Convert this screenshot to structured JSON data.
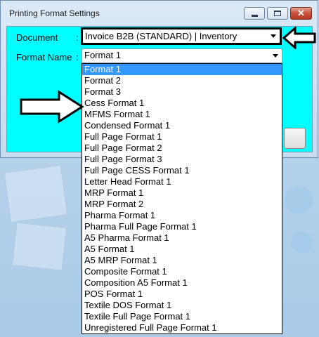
{
  "window": {
    "title": "Printing Format Settings",
    "close_glyph": "✕"
  },
  "form": {
    "document_label": "Document",
    "document_colon": ":",
    "document_value": "Invoice B2B (STANDARD) | Inventory",
    "format_label": "Format Name",
    "format_colon": ":",
    "format_value": "Format 1"
  },
  "dropdown": {
    "selected_index": 0,
    "options": [
      "Format 1",
      "Format 2",
      "Format 3",
      "Cess Format 1",
      "MFMS Format 1",
      "Condensed Format 1",
      "Full Page Format 1",
      "Full Page Format 2",
      "Full Page Format 3",
      "Full Page CESS Format 1",
      "Letter Head Format 1",
      "MRP Format 1",
      "MRP Format 2",
      "Pharma Format 1",
      "Pharma Full Page Format 1",
      "A5 Pharma Format 1",
      "A5 Format 1",
      "A5 MRP Format 1",
      "Composite Format 1",
      "Composition A5 Format 1",
      "POS Format 1",
      "Textile DOS Format 1",
      "Textile Full Page Format 1",
      "Unregistered Full Page Format 1"
    ]
  },
  "colors": {
    "client_bg": "#00ffff",
    "selection": "#3399ff"
  },
  "icons": {
    "minimize": "minimize-icon",
    "maximize": "maximize-icon",
    "close": "close-icon",
    "annotation_arrows": "arrow-annotation-icon"
  }
}
